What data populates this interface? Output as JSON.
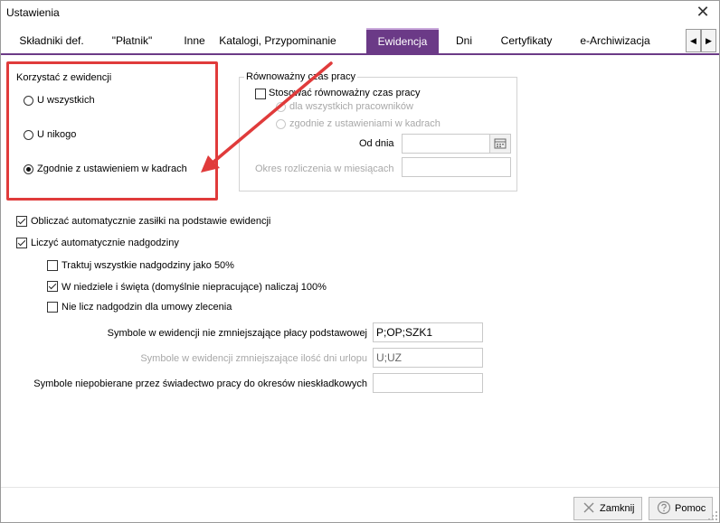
{
  "window": {
    "title": "Ustawienia",
    "close": "✕"
  },
  "tabs": [
    {
      "label": "Składniki def."
    },
    {
      "label": "\"Płatnik\""
    },
    {
      "label": "Inne"
    },
    {
      "label": "Katalogi, Przypominanie"
    },
    {
      "label": "Ewidencja"
    },
    {
      "label": "Dni"
    },
    {
      "label": "Certyfikaty"
    },
    {
      "label": "e-Archiwizacja"
    }
  ],
  "tab_scroll": {
    "left": "◀",
    "right": "▶"
  },
  "usage": {
    "title": "Korzystać z ewidencji",
    "options": [
      {
        "label": "U wszystkich",
        "checked": false
      },
      {
        "label": "U nikogo",
        "checked": false
      },
      {
        "label": "Zgodnie z ustawieniem w kadrach",
        "checked": true
      }
    ]
  },
  "equivalent": {
    "title": "Równoważny czas pracy",
    "apply_label": "Stosować równoważny czas pracy",
    "for_all": "dla wszystkich pracowników",
    "per_hr": "zgodnie z ustawieniami w kadrach",
    "from_day_label": "Od dnia",
    "period_label": "Okres rozliczenia w miesiącach"
  },
  "options": {
    "benefits": {
      "label": "Obliczać automatycznie zasiłki na podstawie ewidencji",
      "checked": true
    },
    "overtime": {
      "label": "Liczyć automatycznie nadgodziny",
      "checked": true
    },
    "overtime_50": {
      "label": "Traktuj wszystkie nadgodziny jako 50%",
      "checked": false
    },
    "sundays_100": {
      "label": "W niedziele i święta (domyślnie niepracujące) naliczaj 100%",
      "checked": true
    },
    "no_contract": {
      "label": "Nie licz nadgodzin dla umowy zlecenia",
      "checked": false
    }
  },
  "symbols": {
    "not_reducing": {
      "label": "Symbole w ewidencji nie zmniejszające płacy podstawowej",
      "value": "P;OP;SZK1"
    },
    "reducing_leave": {
      "label": "Symbole w ewidencji zmniejszające ilość dni urlopu",
      "value": "U;UZ"
    },
    "certificate": {
      "label": "Symbole niepobierane przez świadectwo pracy do okresów nieskładkowych",
      "value": ""
    }
  },
  "buttons": {
    "close": "Zamknij",
    "help": "Pomoc"
  },
  "colors": {
    "accent": "#6b3a87",
    "highlight": "#e03b3b"
  }
}
